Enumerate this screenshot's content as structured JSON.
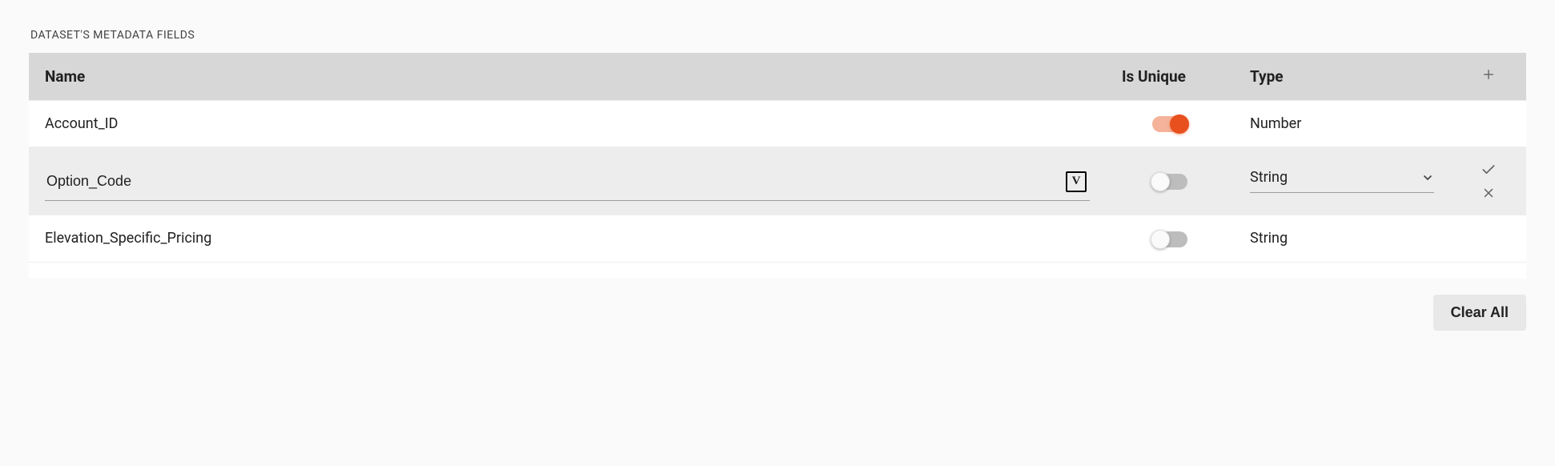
{
  "section_title": "DATASET'S METADATA FIELDS",
  "columns": {
    "name": "Name",
    "is_unique": "Is Unique",
    "type": "Type"
  },
  "rows": [
    {
      "name": "Account_ID",
      "is_unique": true,
      "type": "Number",
      "editing": false
    },
    {
      "name": "Option_Code",
      "is_unique": false,
      "type": "String",
      "editing": true
    },
    {
      "name": "Elevation_Specific_Pricing",
      "is_unique": false,
      "type": "String",
      "editing": false
    }
  ],
  "buttons": {
    "clear_all": "Clear All"
  },
  "icons": {
    "variable_box_letter": "V"
  }
}
